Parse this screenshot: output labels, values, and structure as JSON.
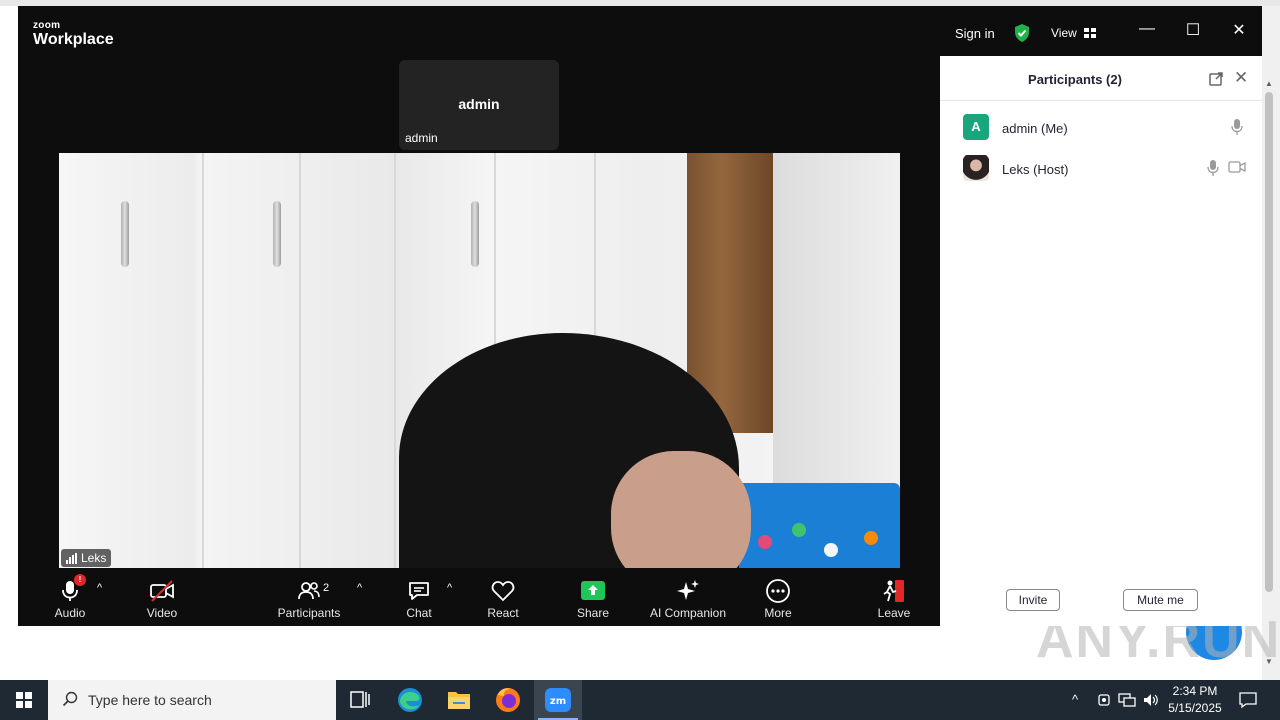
{
  "window": {
    "brand_top": "zoom",
    "brand_bottom": "Workplace",
    "sign_in": "Sign in",
    "view": "View",
    "minimize": "—",
    "maximize": "☐",
    "close": "✕"
  },
  "stage": {
    "admin_tile_name": "admin",
    "admin_tile_label": "admin",
    "video_name_tag": "Leks"
  },
  "toolbar": {
    "audio": "Audio",
    "audio_badge": "!",
    "video": "Video",
    "participants": "Participants",
    "participants_count": "2",
    "chat": "Chat",
    "react": "React",
    "share": "Share",
    "ai_companion": "AI Companion",
    "more": "More",
    "leave": "Leave",
    "caret": "^"
  },
  "panel": {
    "title": "Participants (2)",
    "close": "✕",
    "participants": [
      {
        "initial": "A",
        "name": "admin (Me)",
        "avatar_color": "#1aa67c"
      },
      {
        "initial": "",
        "name": "Leks (Host)"
      }
    ],
    "invite": "Invite",
    "mute_me": "Mute me"
  },
  "taskbar": {
    "search_placeholder": "Type here to search",
    "time": "2:34 PM",
    "date": "5/15/2025"
  },
  "watermark": "ANY.RUN",
  "colors": {
    "zoom_bg": "#0d0d0d",
    "share_green": "#20c55a",
    "shield_green": "#1fb14a",
    "leave_red": "#e02828"
  }
}
